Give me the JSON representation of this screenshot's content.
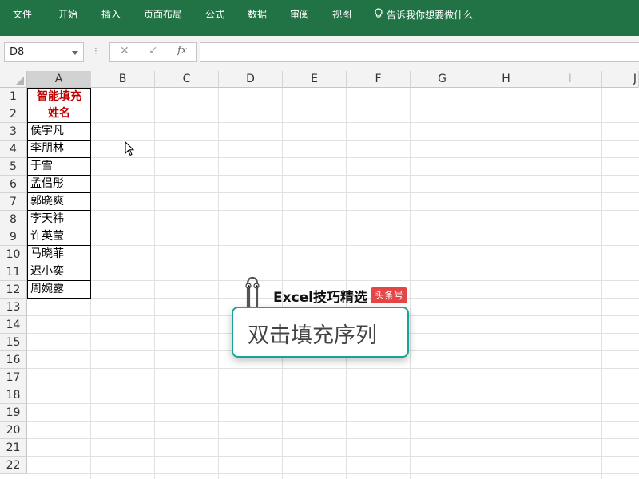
{
  "ribbon": {
    "tabs": [
      "文件",
      "开始",
      "插入",
      "页面布局",
      "公式",
      "数据",
      "审阅",
      "视图"
    ],
    "tell_me": "告诉我你想要做什么"
  },
  "formula_bar": {
    "name_box": "D8",
    "cancel_icon": "✕",
    "enter_icon": "✓",
    "fx_label": "fx",
    "content": ""
  },
  "sheet": {
    "columns": [
      "A",
      "B",
      "C",
      "D",
      "E",
      "F",
      "G",
      "H",
      "I",
      "J"
    ],
    "active_column": "A",
    "rows": [
      "1",
      "2",
      "3",
      "4",
      "5",
      "6",
      "7",
      "8",
      "9",
      "10",
      "11",
      "12",
      "13",
      "14",
      "15",
      "16",
      "17",
      "18",
      "19",
      "20",
      "21",
      "22"
    ],
    "cells_a": [
      {
        "value": "智能填充",
        "header": true
      },
      {
        "value": "姓名",
        "header": true
      },
      {
        "value": "侯宇凡"
      },
      {
        "value": "李朋林"
      },
      {
        "value": "于雪"
      },
      {
        "value": "孟侣彤"
      },
      {
        "value": "郭晓爽"
      },
      {
        "value": "李天祎"
      },
      {
        "value": "许英莹"
      },
      {
        "value": "马晓菲"
      },
      {
        "value": "迟小奕"
      },
      {
        "value": "周婉露"
      }
    ]
  },
  "overlay": {
    "brand": "Excel技巧精选",
    "badge": "头条号",
    "caption": "双击填充序列"
  },
  "colors": {
    "ribbon": "#217346",
    "header_text": "#c00000",
    "popup_border": "#1aa39a",
    "badge": "#e64545"
  }
}
